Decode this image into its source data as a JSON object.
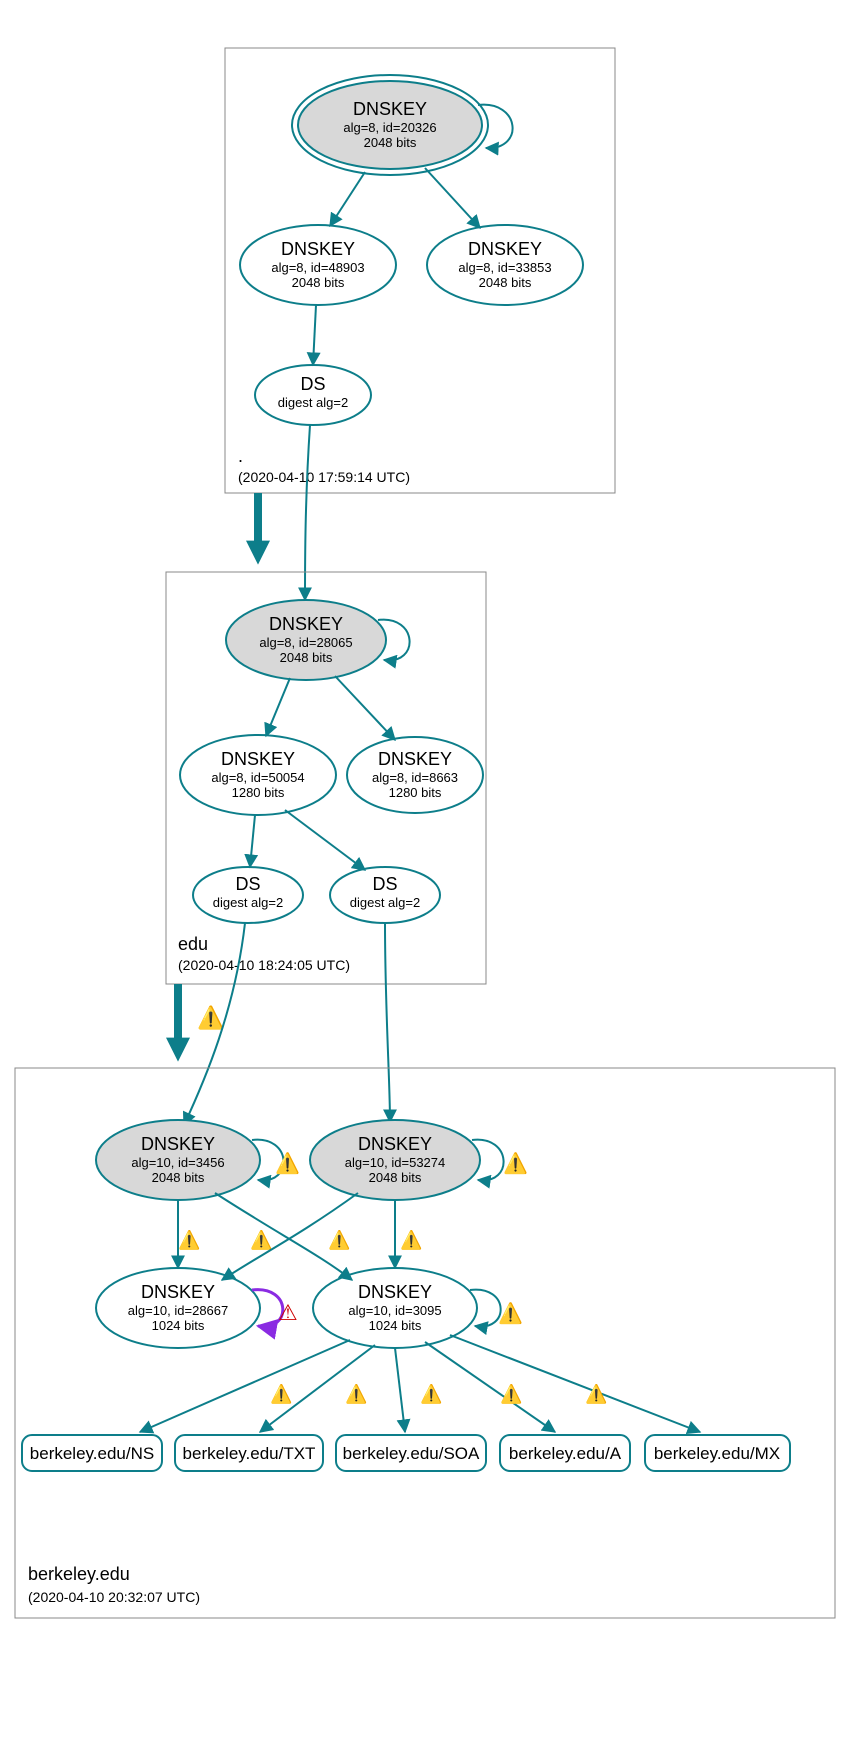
{
  "zones": {
    "root": {
      "name": ".",
      "timestamp": "(2020-04-10 17:59:14 UTC)"
    },
    "edu": {
      "name": "edu",
      "timestamp": "(2020-04-10 18:24:05 UTC)"
    },
    "berk": {
      "name": "berkeley.edu",
      "timestamp": "(2020-04-10 20:32:07 UTC)"
    }
  },
  "nodes": {
    "root_ksk": {
      "title": "DNSKEY",
      "sub1": "alg=8, id=20326",
      "sub2": "2048 bits"
    },
    "root_zsk1": {
      "title": "DNSKEY",
      "sub1": "alg=8, id=48903",
      "sub2": "2048 bits"
    },
    "root_zsk2": {
      "title": "DNSKEY",
      "sub1": "alg=8, id=33853",
      "sub2": "2048 bits"
    },
    "root_ds": {
      "title": "DS",
      "sub1": "digest alg=2"
    },
    "edu_ksk": {
      "title": "DNSKEY",
      "sub1": "alg=8, id=28065",
      "sub2": "2048 bits"
    },
    "edu_zsk1": {
      "title": "DNSKEY",
      "sub1": "alg=8, id=50054",
      "sub2": "1280 bits"
    },
    "edu_zsk2": {
      "title": "DNSKEY",
      "sub1": "alg=8, id=8663",
      "sub2": "1280 bits"
    },
    "edu_ds1": {
      "title": "DS",
      "sub1": "digest alg=2"
    },
    "edu_ds2": {
      "title": "DS",
      "sub1": "digest alg=2"
    },
    "berk_ksk1": {
      "title": "DNSKEY",
      "sub1": "alg=10, id=3456",
      "sub2": "2048 bits"
    },
    "berk_ksk2": {
      "title": "DNSKEY",
      "sub1": "alg=10, id=53274",
      "sub2": "2048 bits"
    },
    "berk_zsk1": {
      "title": "DNSKEY",
      "sub1": "alg=10, id=28667",
      "sub2": "1024 bits"
    },
    "berk_zsk2": {
      "title": "DNSKEY",
      "sub1": "alg=10, id=3095",
      "sub2": "1024 bits"
    }
  },
  "rrsets": {
    "ns": "berkeley.edu/NS",
    "txt": "berkeley.edu/TXT",
    "soa": "berkeley.edu/SOA",
    "a": "berkeley.edu/A",
    "mx": "berkeley.edu/MX"
  },
  "icons": {
    "warn_yellow": "⚠",
    "warn_red": "⚠"
  }
}
